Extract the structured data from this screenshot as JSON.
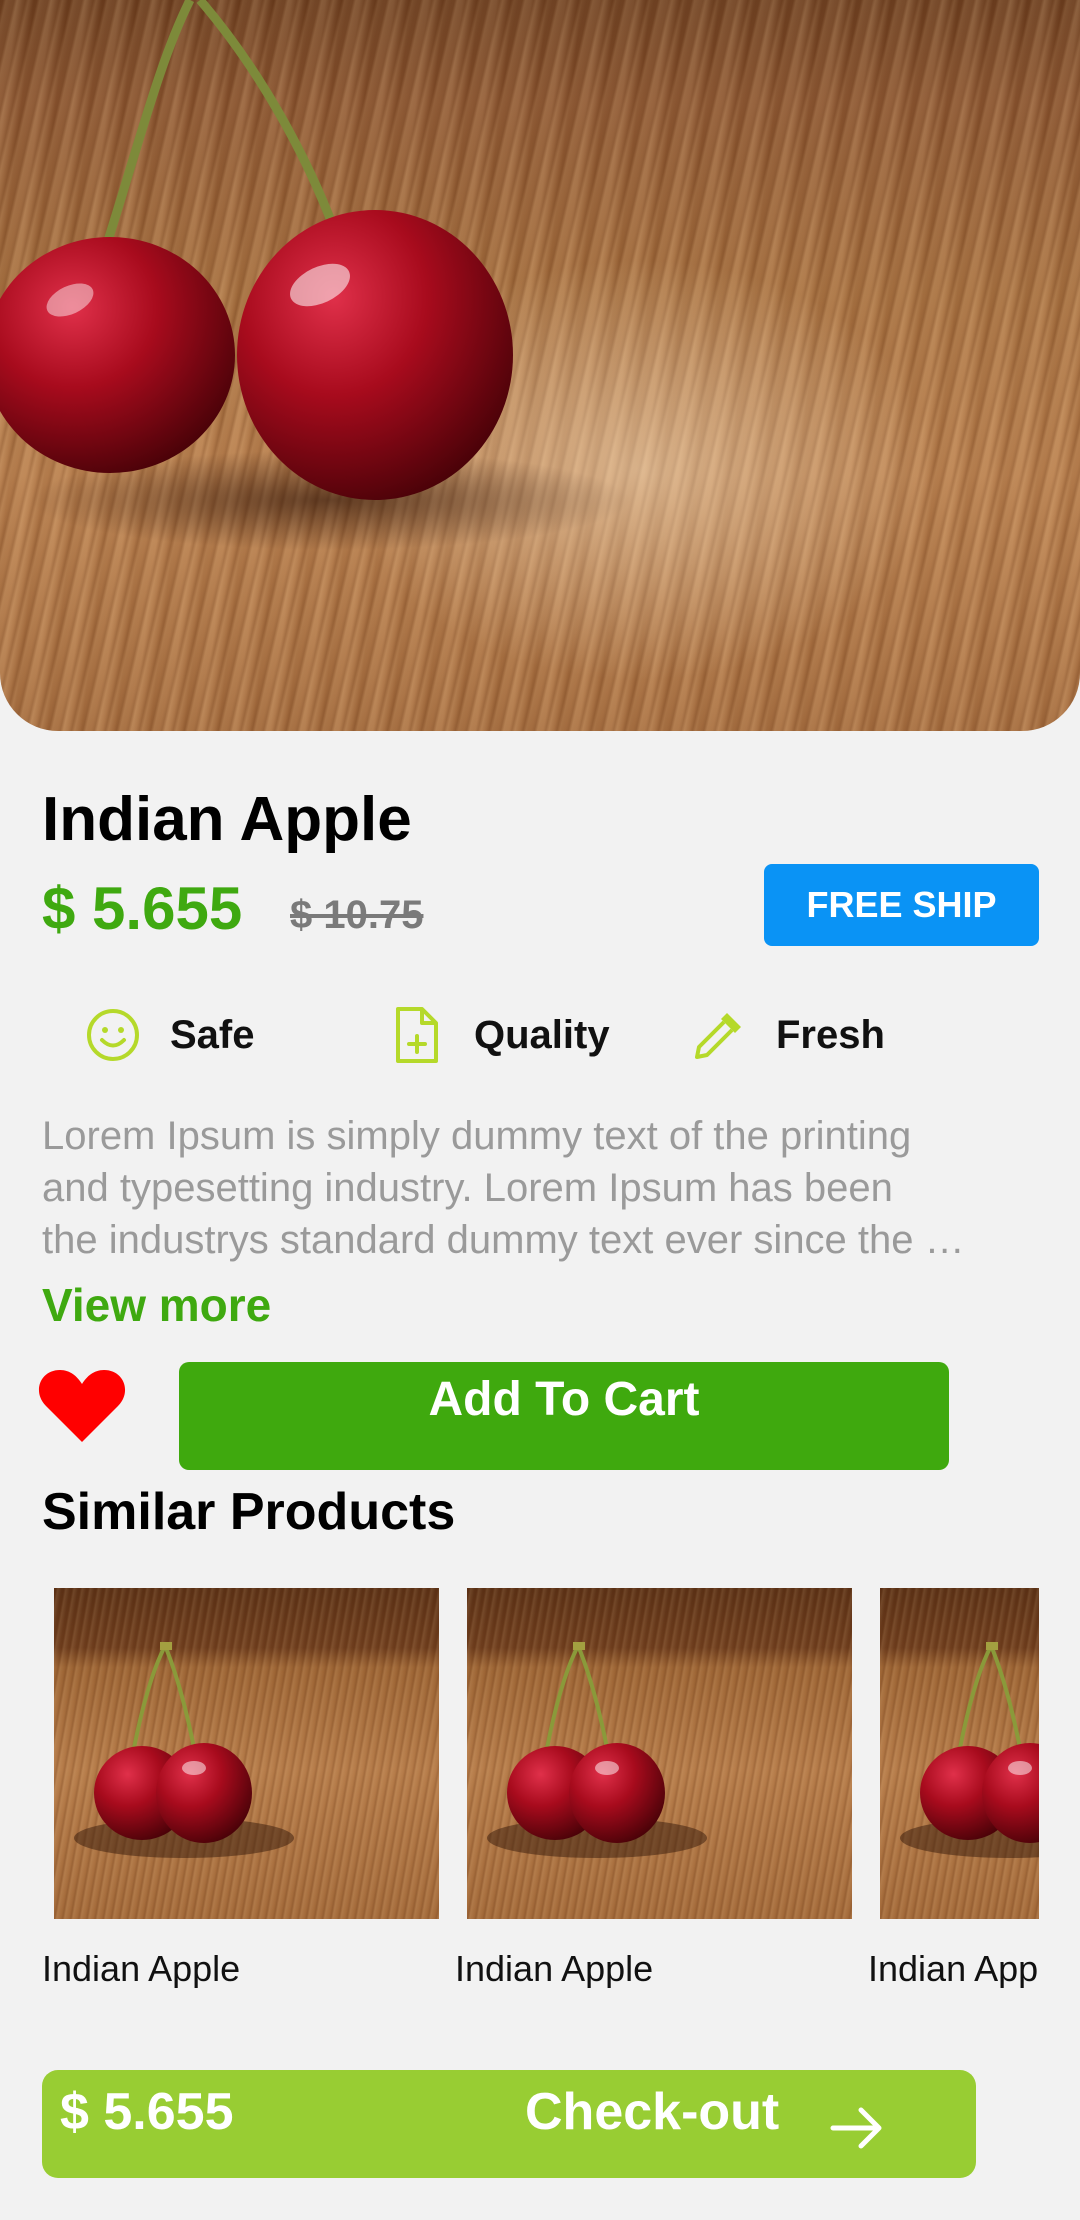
{
  "product": {
    "title": "Indian Apple",
    "price": "$ 5.655",
    "old_price": "$ 10.75",
    "badge": "FREE SHIP"
  },
  "features": [
    {
      "icon": "smile-icon",
      "label": "Safe"
    },
    {
      "icon": "file-plus-icon",
      "label": "Quality"
    },
    {
      "icon": "dropper-icon",
      "label": "Fresh"
    }
  ],
  "description": {
    "lines": [
      "Lorem Ipsum is simply dummy text of the printing",
      "and typesetting industry. Lorem Ipsum has been",
      "the industrys standard dummy text ever since the …"
    ],
    "view_more": "View more"
  },
  "actions": {
    "add_to_cart": "Add To Cart",
    "favorite_icon": "heart-icon"
  },
  "similar": {
    "title": "Similar Products",
    "items": [
      {
        "label": "Indian Apple"
      },
      {
        "label": "Indian Apple"
      },
      {
        "label": "Indian Apple"
      }
    ]
  },
  "checkout": {
    "price": "$ 5.655",
    "label": "Check-out",
    "icon": "arrow-right-icon"
  },
  "colors": {
    "accent_green": "#3fa910",
    "checkout_green": "#98cd33",
    "badge_blue": "#0a93f5",
    "favorite_red": "#ff0000",
    "feature_icon_lime": "#b5d92a"
  }
}
